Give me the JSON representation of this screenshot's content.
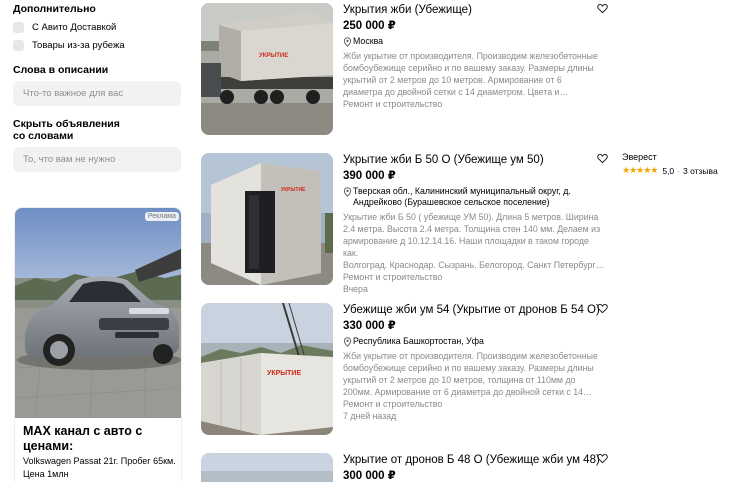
{
  "filters": {
    "additional_title": "Дополнительно",
    "options": [
      {
        "label": "С Авито Доставкой"
      },
      {
        "label": "Товары из-за рубежа"
      }
    ],
    "words_title": "Слова в описании",
    "words_placeholder": "Что-то важное для вас",
    "hide_title_line1": "Скрыть объявления",
    "hide_title_line2": "со словами",
    "hide_placeholder": "То, что вам не нужно"
  },
  "ad": {
    "badge": "Реклама",
    "title": "MAX канал с авто с ценами:",
    "desc_line1": "Volkswagen Passat 21г. Пробег 65км.",
    "desc_line2": "Цена 1млн"
  },
  "listings": [
    {
      "title": "Укрытия жби (Убежище)",
      "price": "250 000 ₽",
      "location": "Москва",
      "desc_line1": "Жби укрытие от производителя. Производим железобетонные",
      "desc_line2": "бомбоубежище серийно и по вашему заказу. Размеры длины",
      "desc_line3": "укрытий от 2 метров до 10 метров. Армирование от 6",
      "desc_line4": "диаметра до двойной сетки с 14 диаметром. Цвета и…",
      "category": "Ремонт и строительство",
      "date": ""
    },
    {
      "title": "Укрытие жби Б 50 О (Убежище ум 50)",
      "price": "390 000 ₽",
      "location_line1": "Тверская обл., Калининский муниципальный округ, д.",
      "location_line2": "Андрейково (Бурашевское сельское поселение)",
      "desc_line1": "Укрытие жби Б 50 ( убежище УМ 50). Длина 5 метров. Ширина",
      "desc_line2": "2.4 метра. Высота 2.4 метра. Толщина стен 140 мм. Делаем из",
      "desc_line3": "армирование д 10.12.14.16. Наши площадки в таком городе как.",
      "desc_line4": "Волгоград. Краснодар. Сызрань. Белогород. Санкт Петербург…",
      "category": "Ремонт и строительство",
      "date": "Вчера"
    },
    {
      "title": "Убежище жби ум 54 (Укрытие от дронов Б 54 О)",
      "price": "330 000 ₽",
      "location": "Республика Башкортостан, Уфа",
      "desc_line1": "Жби укрытие от производителя. Производим железобетонные",
      "desc_line2": "бомбоубежище серийно и по вашему заказу. Размеры длины",
      "desc_line3": "укрытий от 2 метров до 10 метров, толщина от 110мм до",
      "desc_line4": "200мм. Армирование от 6 диаметра до двойной сетки с 14…",
      "category": "Ремонт и строительство",
      "date": "7 дней назад"
    },
    {
      "title": "Укрытие от дронов Б 48 О (Убежище жби ум 48)",
      "price": "300 000 ₽"
    }
  ],
  "seller": {
    "name": "Эверест",
    "stars": "★★★★★",
    "rating": "5,0",
    "dot": "·",
    "reviews": "3 отзыва"
  },
  "colors": {
    "star": "#f7a400",
    "muted_text": "#8a8a8a",
    "input_bg": "#f2f2f2",
    "shelter_label": "#d1271a"
  },
  "icons": {
    "heart": "heart-outline-icon",
    "location": "location-pin-icon"
  }
}
